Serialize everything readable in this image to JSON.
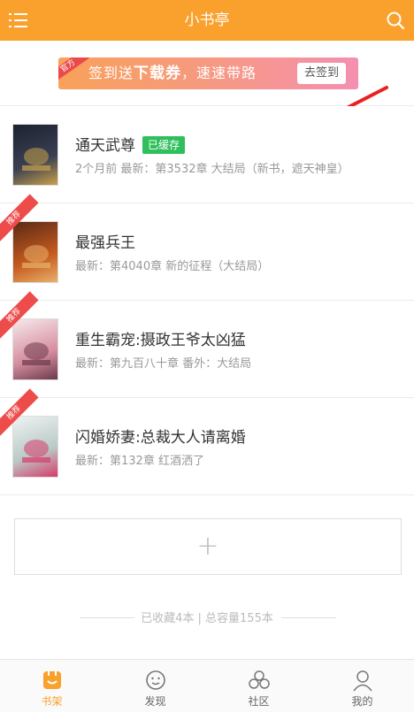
{
  "header": {
    "title": "小书亭"
  },
  "banner": {
    "tag": "官方",
    "text_prefix": "签到送",
    "text_bold": "下载券",
    "text_suffix": "，速速带路",
    "button": "去签到"
  },
  "books": [
    {
      "title": "通天武尊",
      "cached_badge": "已缓存",
      "meta": "2个月前 最新：第3532章 大结局（新书，遮天神皇）",
      "ribbon": "",
      "cover_colors": [
        "#1c2231",
        "#3a3f52",
        "#c9a24b"
      ]
    },
    {
      "title": "最强兵王",
      "cached_badge": "",
      "meta": "最新：第4040章 新的征程（大结局）",
      "ribbon": "推荐",
      "cover_colors": [
        "#5a2a14",
        "#c55a1f",
        "#e8b16a"
      ]
    },
    {
      "title": "重生霸宠:摄政王爷太凶猛",
      "cached_badge": "",
      "meta": "最新：第九百八十章 番外：大结局",
      "ribbon": "推荐",
      "cover_colors": [
        "#f6e9ea",
        "#d68ea0",
        "#6b3a4a"
      ]
    },
    {
      "title": "闪婚娇妻:总裁大人请离婚",
      "cached_badge": "",
      "meta": "最新：第132章 红酒洒了",
      "ribbon": "推荐",
      "cover_colors": [
        "#eef3f2",
        "#b9c9c6",
        "#d83a6a"
      ]
    }
  ],
  "add_button": {
    "symbol": "+"
  },
  "stats": {
    "text": "已收藏4本 | 总容量155本"
  },
  "tabs": [
    {
      "label": "书架",
      "icon": "bookshelf-icon",
      "active": true
    },
    {
      "label": "发现",
      "icon": "discover-icon",
      "active": false
    },
    {
      "label": "社区",
      "icon": "community-icon",
      "active": false
    },
    {
      "label": "我的",
      "icon": "profile-icon",
      "active": false
    }
  ],
  "colors": {
    "brand": "#f9a12c",
    "cached": "#2fbf5c",
    "ribbon": "#ee4b4b",
    "arrow": "#e8231f"
  }
}
